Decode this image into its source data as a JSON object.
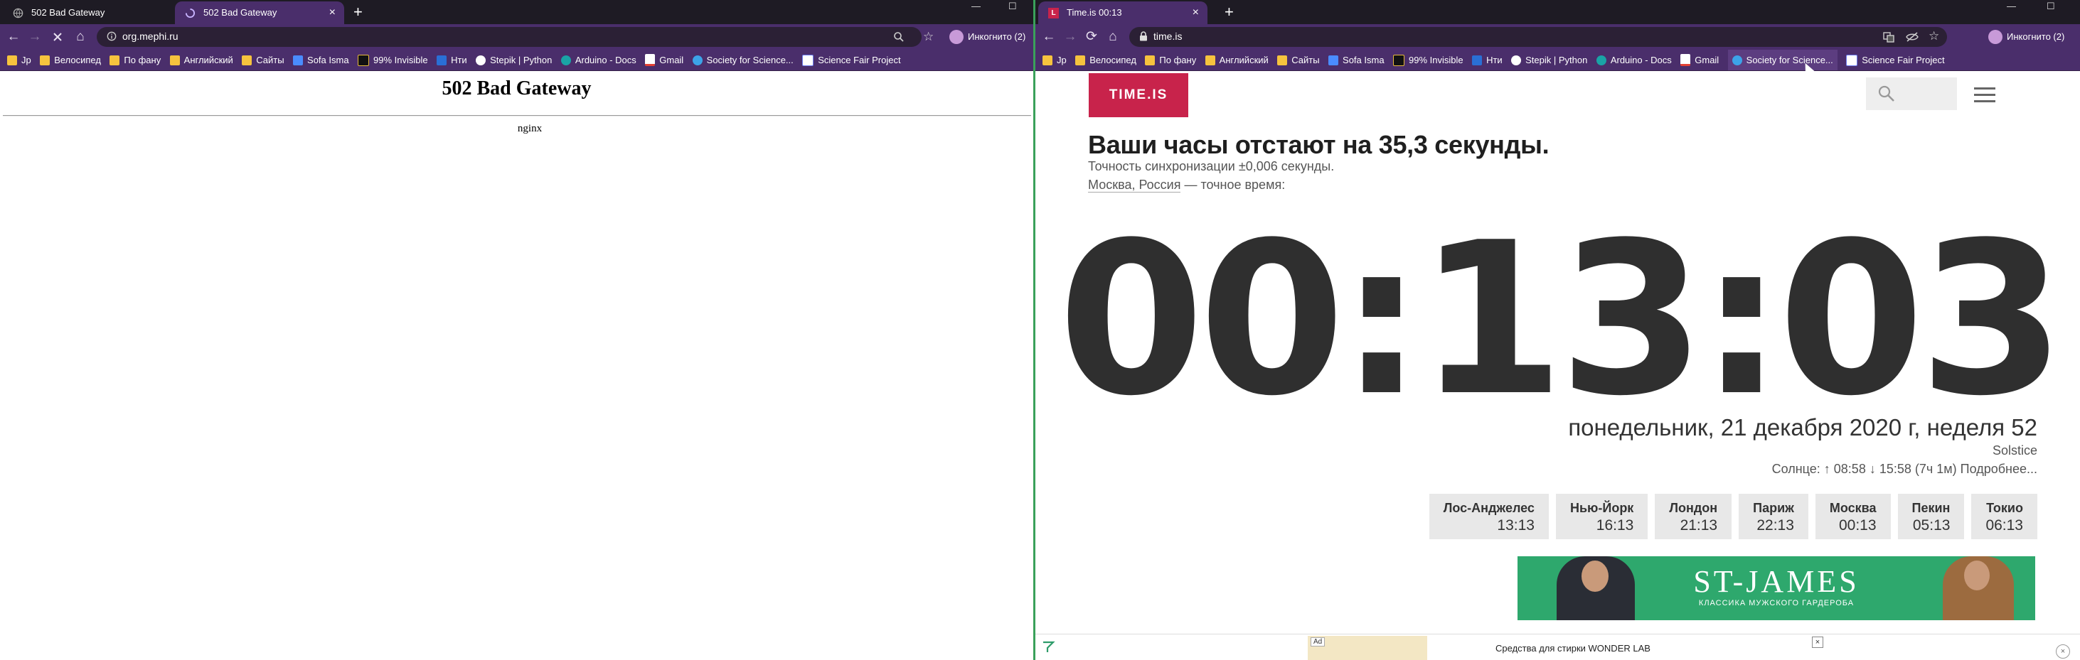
{
  "left_window": {
    "tabs": [
      {
        "title": "502 Bad Gateway"
      },
      {
        "title": "502 Bad Gateway"
      }
    ],
    "new_tab_symbol": "+",
    "url": "org.mephi.ru",
    "profile_label": "Инкогнито (2)",
    "page": {
      "title": "502 Bad Gateway",
      "server": "nginx"
    }
  },
  "right_window": {
    "tabs": [
      {
        "title": "Time.is 00:13"
      }
    ],
    "new_tab_symbol": "+",
    "url": "time.is",
    "profile_label": "Инкогнито (2)",
    "page": {
      "logo": "TIME.IS",
      "headline": "Ваши часы отстают на 35,3 секунды.",
      "sync_accuracy": "Точность синхронизации ±0,006 секунды.",
      "location_link": "Москва, Россия",
      "location_suffix": " — точное время:",
      "clock": "00:13:03",
      "date": "понедельник, 21 декабря 2020 г, неделя 52",
      "event": "Solstice",
      "sun": "Солнце: ↑ 08:58 ↓ 15:58 (7ч 1м) Подробнее...",
      "cities": [
        {
          "name": "Лос-Анджелес",
          "time": "13:13"
        },
        {
          "name": "Нью-Йорк",
          "time": "16:13"
        },
        {
          "name": "Лондон",
          "time": "21:13"
        },
        {
          "name": "Париж",
          "time": "22:13"
        },
        {
          "name": "Москва",
          "time": "00:13"
        },
        {
          "name": "Пекин",
          "time": "05:13"
        },
        {
          "name": "Токио",
          "time": "06:13"
        }
      ],
      "banner_brand": "ST-JAMES",
      "banner_sub": "КЛАССИКА МУЖСКОГО ГАРДЕРОБА",
      "ad_label": "Ad",
      "ad_text": "Средства для стирки WONDER LAB"
    }
  },
  "bookmarks": [
    {
      "label": "Jp",
      "type": "folder"
    },
    {
      "label": "Велосипед",
      "type": "folder"
    },
    {
      "label": "По фану",
      "type": "folder"
    },
    {
      "label": "Английский",
      "type": "folder"
    },
    {
      "label": "Сайты",
      "type": "folder"
    },
    {
      "label": "Sofa Isma",
      "type": "site"
    },
    {
      "label": "99% Invisible",
      "type": "site"
    },
    {
      "label": "Нти",
      "type": "site"
    },
    {
      "label": "Stepik | Python",
      "type": "site"
    },
    {
      "label": "Arduino - Docs",
      "type": "site"
    },
    {
      "label": "Gmail",
      "type": "site"
    },
    {
      "label": "Society for Science...",
      "type": "site"
    },
    {
      "label": "Science Fair Project",
      "type": "site"
    }
  ],
  "icons": {
    "back": "←",
    "forward": "→",
    "reload": "⟳",
    "home": "⌂",
    "lock": "🔒",
    "star": "☆",
    "search": "⚲",
    "close": "×",
    "minimize": "—",
    "maximize": "☐"
  },
  "colors": {
    "tab_strip": "#1e1b24",
    "toolbar_incognito": "#4a2e6b",
    "timeis_red": "#c8234b",
    "banner_green": "#2ea86d"
  }
}
